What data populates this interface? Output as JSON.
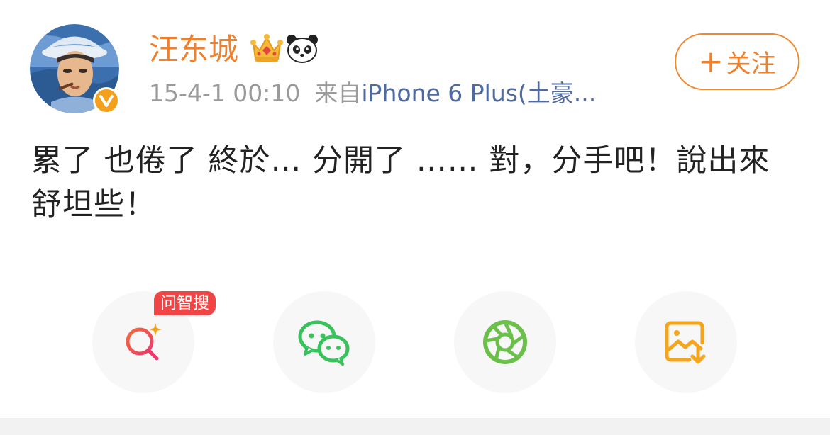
{
  "user": {
    "name": "汪东城",
    "verified": true,
    "badges": [
      "crown-icon",
      "panda-icon"
    ]
  },
  "post": {
    "time": "15-4-1 00:10",
    "source_prefix": "来自",
    "source": "iPhone 6 Plus(土豪...",
    "text": "累了 也倦了 終於… 分開了 …… 對，分手吧！說出來舒坦些！"
  },
  "follow": {
    "plus": "+",
    "label": "关注"
  },
  "share": {
    "ai_badge": "问智搜",
    "items": [
      "search-ai",
      "wechat",
      "moments",
      "save-image"
    ]
  },
  "colors": {
    "name": "#f0802c",
    "source_link": "#4e6aa0",
    "meta": "#9a9a9a",
    "badge_red": "#f14444",
    "wechat_green": "#38c25c",
    "moments_green": "#6bc04b",
    "save_orange": "#f3a51e",
    "search_red": "#ef4454"
  }
}
